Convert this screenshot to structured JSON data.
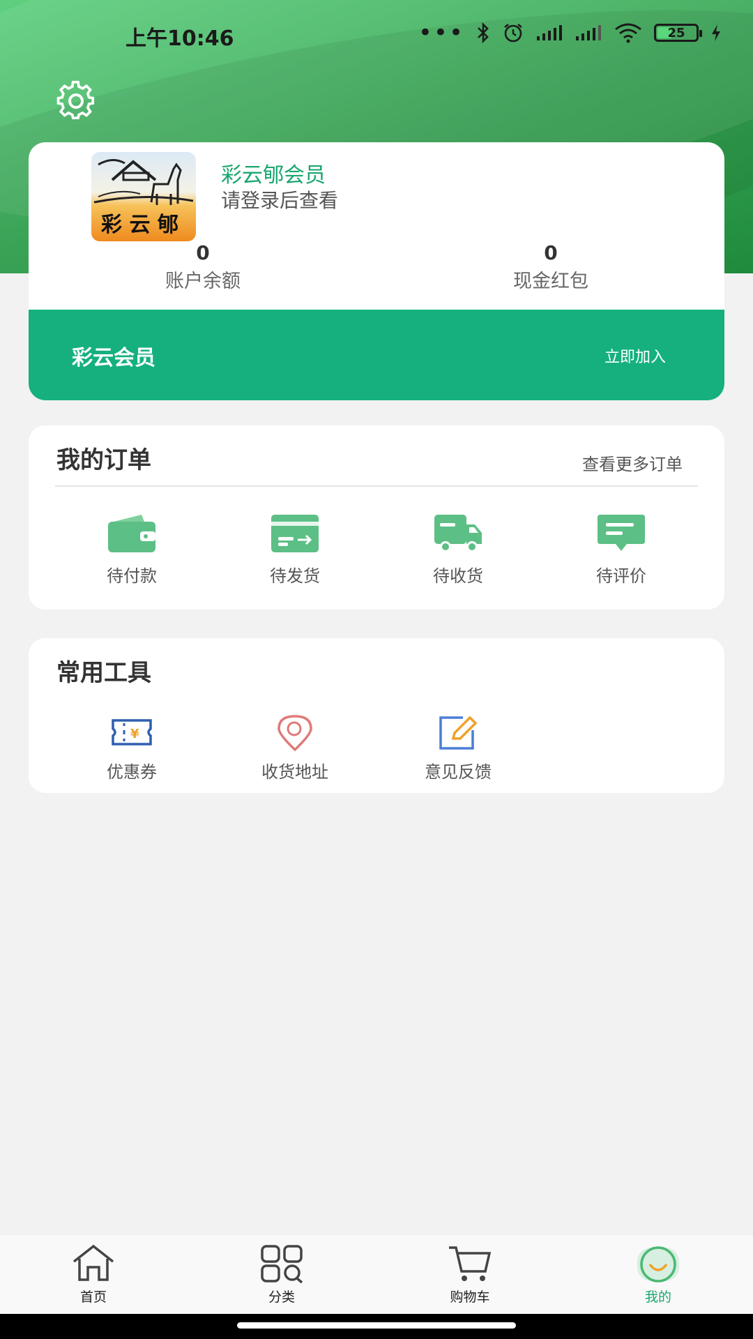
{
  "status_bar": {
    "time": "上午10:46",
    "battery": "25"
  },
  "profile": {
    "member_name": "彩云郇会员",
    "login_hint": "请登录后查看",
    "balance": {
      "value": "0",
      "label": "账户余额"
    },
    "cash": {
      "value": "0",
      "label": "现金红包"
    },
    "vip": {
      "title": "彩云会员",
      "join_label": "立即加入"
    }
  },
  "orders": {
    "title": "我的订单",
    "more_label": "查看更多订单",
    "items": [
      {
        "label": "待付款",
        "icon": "wallet-icon"
      },
      {
        "label": "待发货",
        "icon": "card-transfer-icon"
      },
      {
        "label": "待收货",
        "icon": "truck-icon"
      },
      {
        "label": "待评价",
        "icon": "chat-icon"
      }
    ]
  },
  "tools": {
    "title": "常用工具",
    "items": [
      {
        "label": "优惠券",
        "icon": "coupon-icon"
      },
      {
        "label": "收货地址",
        "icon": "location-pin-icon"
      },
      {
        "label": "意见反馈",
        "icon": "edit-icon"
      }
    ]
  },
  "bottom_nav": {
    "items": [
      {
        "label": "首页",
        "icon": "home-icon"
      },
      {
        "label": "分类",
        "icon": "category-icon"
      },
      {
        "label": "购物车",
        "icon": "cart-icon"
      },
      {
        "label": "我的",
        "icon": "profile-icon",
        "active": true
      }
    ]
  },
  "colors": {
    "brand_green": "#15b07e",
    "header_green": "#3fae5c",
    "icon_green": "#5cbf85",
    "active_text": "#19a66e"
  }
}
